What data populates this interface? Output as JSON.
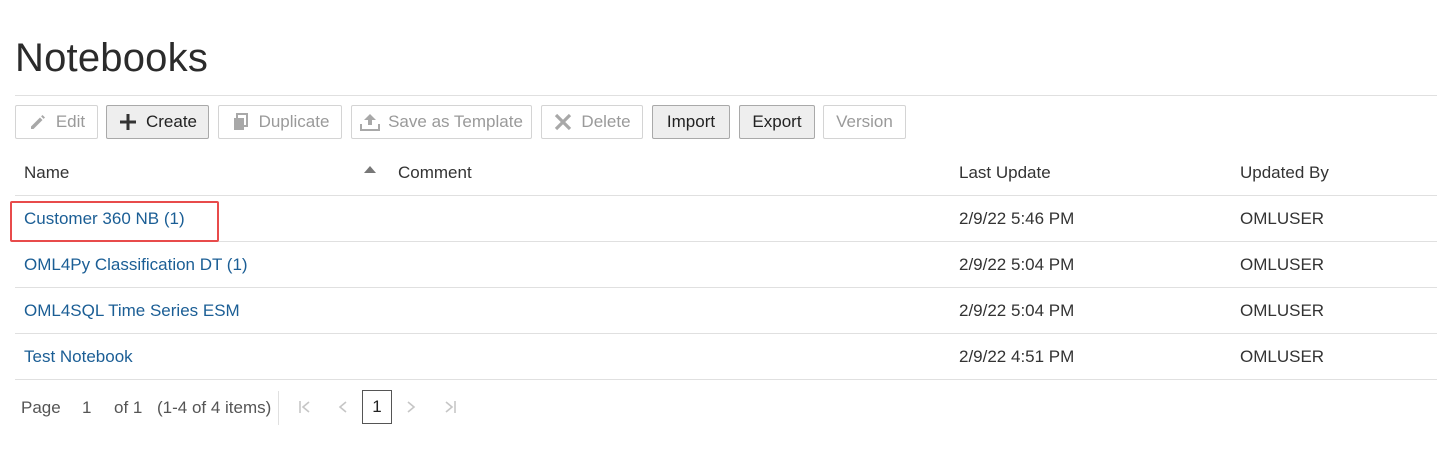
{
  "page": {
    "title": "Notebooks"
  },
  "toolbar": {
    "buttons": [
      {
        "label": "Edit",
        "icon": "pencil-icon",
        "enabled": false
      },
      {
        "label": "Create",
        "icon": "plus-icon",
        "enabled": true
      },
      {
        "label": "Duplicate",
        "icon": "copy-icon",
        "enabled": false
      },
      {
        "label": "Save as Template",
        "icon": "upload-icon",
        "enabled": false
      },
      {
        "label": "Delete",
        "icon": "x-icon",
        "enabled": false
      },
      {
        "label": "Import",
        "enabled": true
      },
      {
        "label": "Export",
        "enabled": true
      },
      {
        "label": "Version",
        "enabled": false
      }
    ]
  },
  "table": {
    "columns": {
      "name": "Name",
      "comment": "Comment",
      "last_update": "Last Update",
      "updated_by": "Updated By"
    },
    "sort": {
      "column": "Name",
      "direction": "ascending"
    },
    "rows": [
      {
        "name": "Customer 360 NB (1)",
        "comment": "",
        "last_update": "2/9/22 5:46 PM",
        "updated_by": "OMLUSER",
        "highlighted": true
      },
      {
        "name": "OML4Py Classification DT (1)",
        "comment": "",
        "last_update": "2/9/22 5:04 PM",
        "updated_by": "OMLUSER"
      },
      {
        "name": "OML4SQL Time Series ESM",
        "comment": "",
        "last_update": "2/9/22 5:04 PM",
        "updated_by": "OMLUSER"
      },
      {
        "name": "Test Notebook",
        "comment": "",
        "last_update": "2/9/22 4:51 PM",
        "updated_by": "OMLUSER"
      }
    ]
  },
  "pagination": {
    "page_label": "Page",
    "current_page": "1",
    "of_label": "of 1",
    "items_summary": "(1-4 of 4 items)",
    "page_button": "1"
  },
  "colors": {
    "link": "#1b5e95",
    "highlight_box": "#e84b4b",
    "enabled_button_bg": "#eeeeee",
    "disabled_text": "#9a9a9a"
  }
}
